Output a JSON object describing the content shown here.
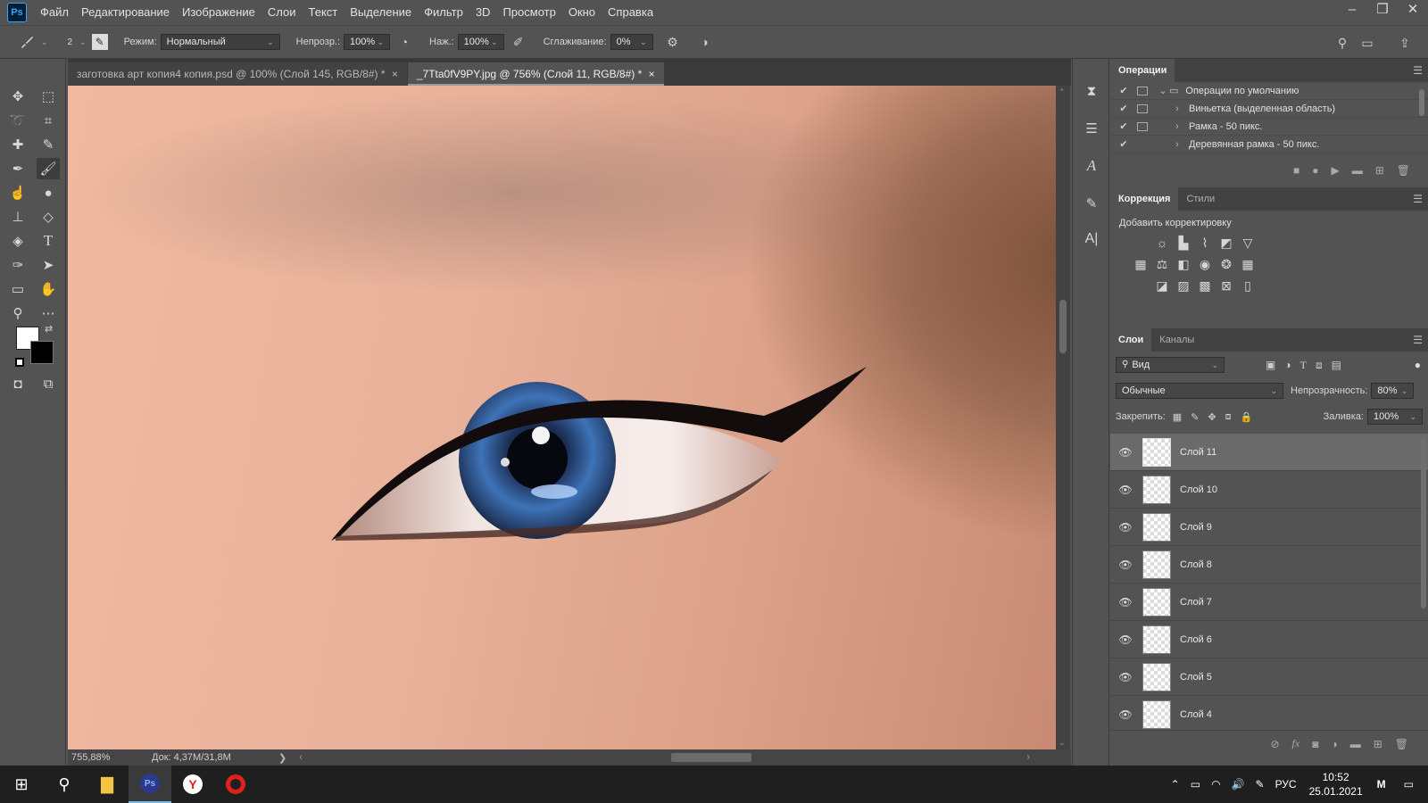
{
  "menubar": {
    "logo": "Ps",
    "items": [
      "Файл",
      "Редактирование",
      "Изображение",
      "Слои",
      "Текст",
      "Выделение",
      "Фильтр",
      "3D",
      "Просмотр",
      "Окно",
      "Справка"
    ]
  },
  "options": {
    "brush_size": "2",
    "mode_label": "Режим:",
    "mode_value": "Нормальный",
    "opacity_label": "Непрозр.:",
    "opacity_value": "100%",
    "pressure_label": "Наж.:",
    "pressure_value": "100%",
    "smoothing_label": "Сглаживание:",
    "smoothing_value": "0%"
  },
  "tabs": [
    {
      "label": "заготовка арт копия4 копия.psd @ 100% (Слой 145, RGB/8#) *",
      "close": "×"
    },
    {
      "label": "_7Tta0fV9PY.jpg @ 756% (Слой 11, RGB/8#) *",
      "close": "×"
    }
  ],
  "status": {
    "zoom": "755,88%",
    "doc": "Док: 4,37M/31,8M",
    "arrow": "❯"
  },
  "actions_panel": {
    "tab": "Операции",
    "items": [
      {
        "label": "Операции по умолчанию",
        "expanded": true
      },
      {
        "label": "Виньетка (выделенная область)"
      },
      {
        "label": "Рамка - 50 пикс."
      },
      {
        "label": "Деревянная рамка - 50 пикс."
      }
    ]
  },
  "adjust_panel": {
    "tab_active": "Коррекция",
    "tab_other": "Стили",
    "title": "Добавить корректировку"
  },
  "layers_panel": {
    "tab_active": "Слои",
    "tab_other": "Каналы",
    "filter_placeholder": "Вид",
    "blend_mode": "Обычные",
    "opacity_label": "Непрозрачность:",
    "opacity_value": "80%",
    "lock_label": "Закрепить:",
    "fill_label": "Заливка:",
    "fill_value": "100%",
    "layers": [
      {
        "name": "Слой 11",
        "selected": true
      },
      {
        "name": "Слой 10"
      },
      {
        "name": "Слой 9"
      },
      {
        "name": "Слой 8"
      },
      {
        "name": "Слой 7"
      },
      {
        "name": "Слой 6"
      },
      {
        "name": "Слой 5"
      },
      {
        "name": "Слой 4"
      }
    ]
  },
  "taskbar": {
    "lang": "РУС",
    "time": "10:52",
    "date": "25.01.2021"
  },
  "colors": {
    "accent": "#31a8ff",
    "panel_bg": "#535353",
    "dark_bg": "#3a3a3a",
    "iris": "#2c5fa8"
  }
}
